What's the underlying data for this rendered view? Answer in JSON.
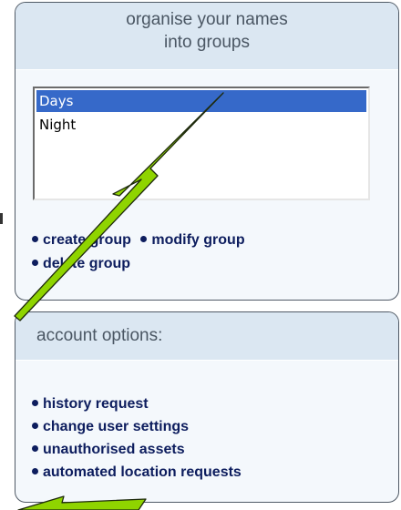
{
  "groups_panel": {
    "title_line1": "organise your names",
    "title_line2": "into groups",
    "list_items": [
      "Days",
      "Night"
    ],
    "selected_item": "Days",
    "actions": {
      "create": "create group",
      "modify": "modify group",
      "delete": "delete group"
    }
  },
  "account_panel": {
    "title": "account options:",
    "links": [
      "history request",
      "change user settings",
      "unauthorised assets",
      "automated location requests"
    ]
  },
  "colors": {
    "arrow_fill": "#8fd400",
    "arrow_outline": "#1e2a0c",
    "selection": "#3669c9",
    "link": "#0d1d5e",
    "panel_header": "#dbe7f2"
  }
}
